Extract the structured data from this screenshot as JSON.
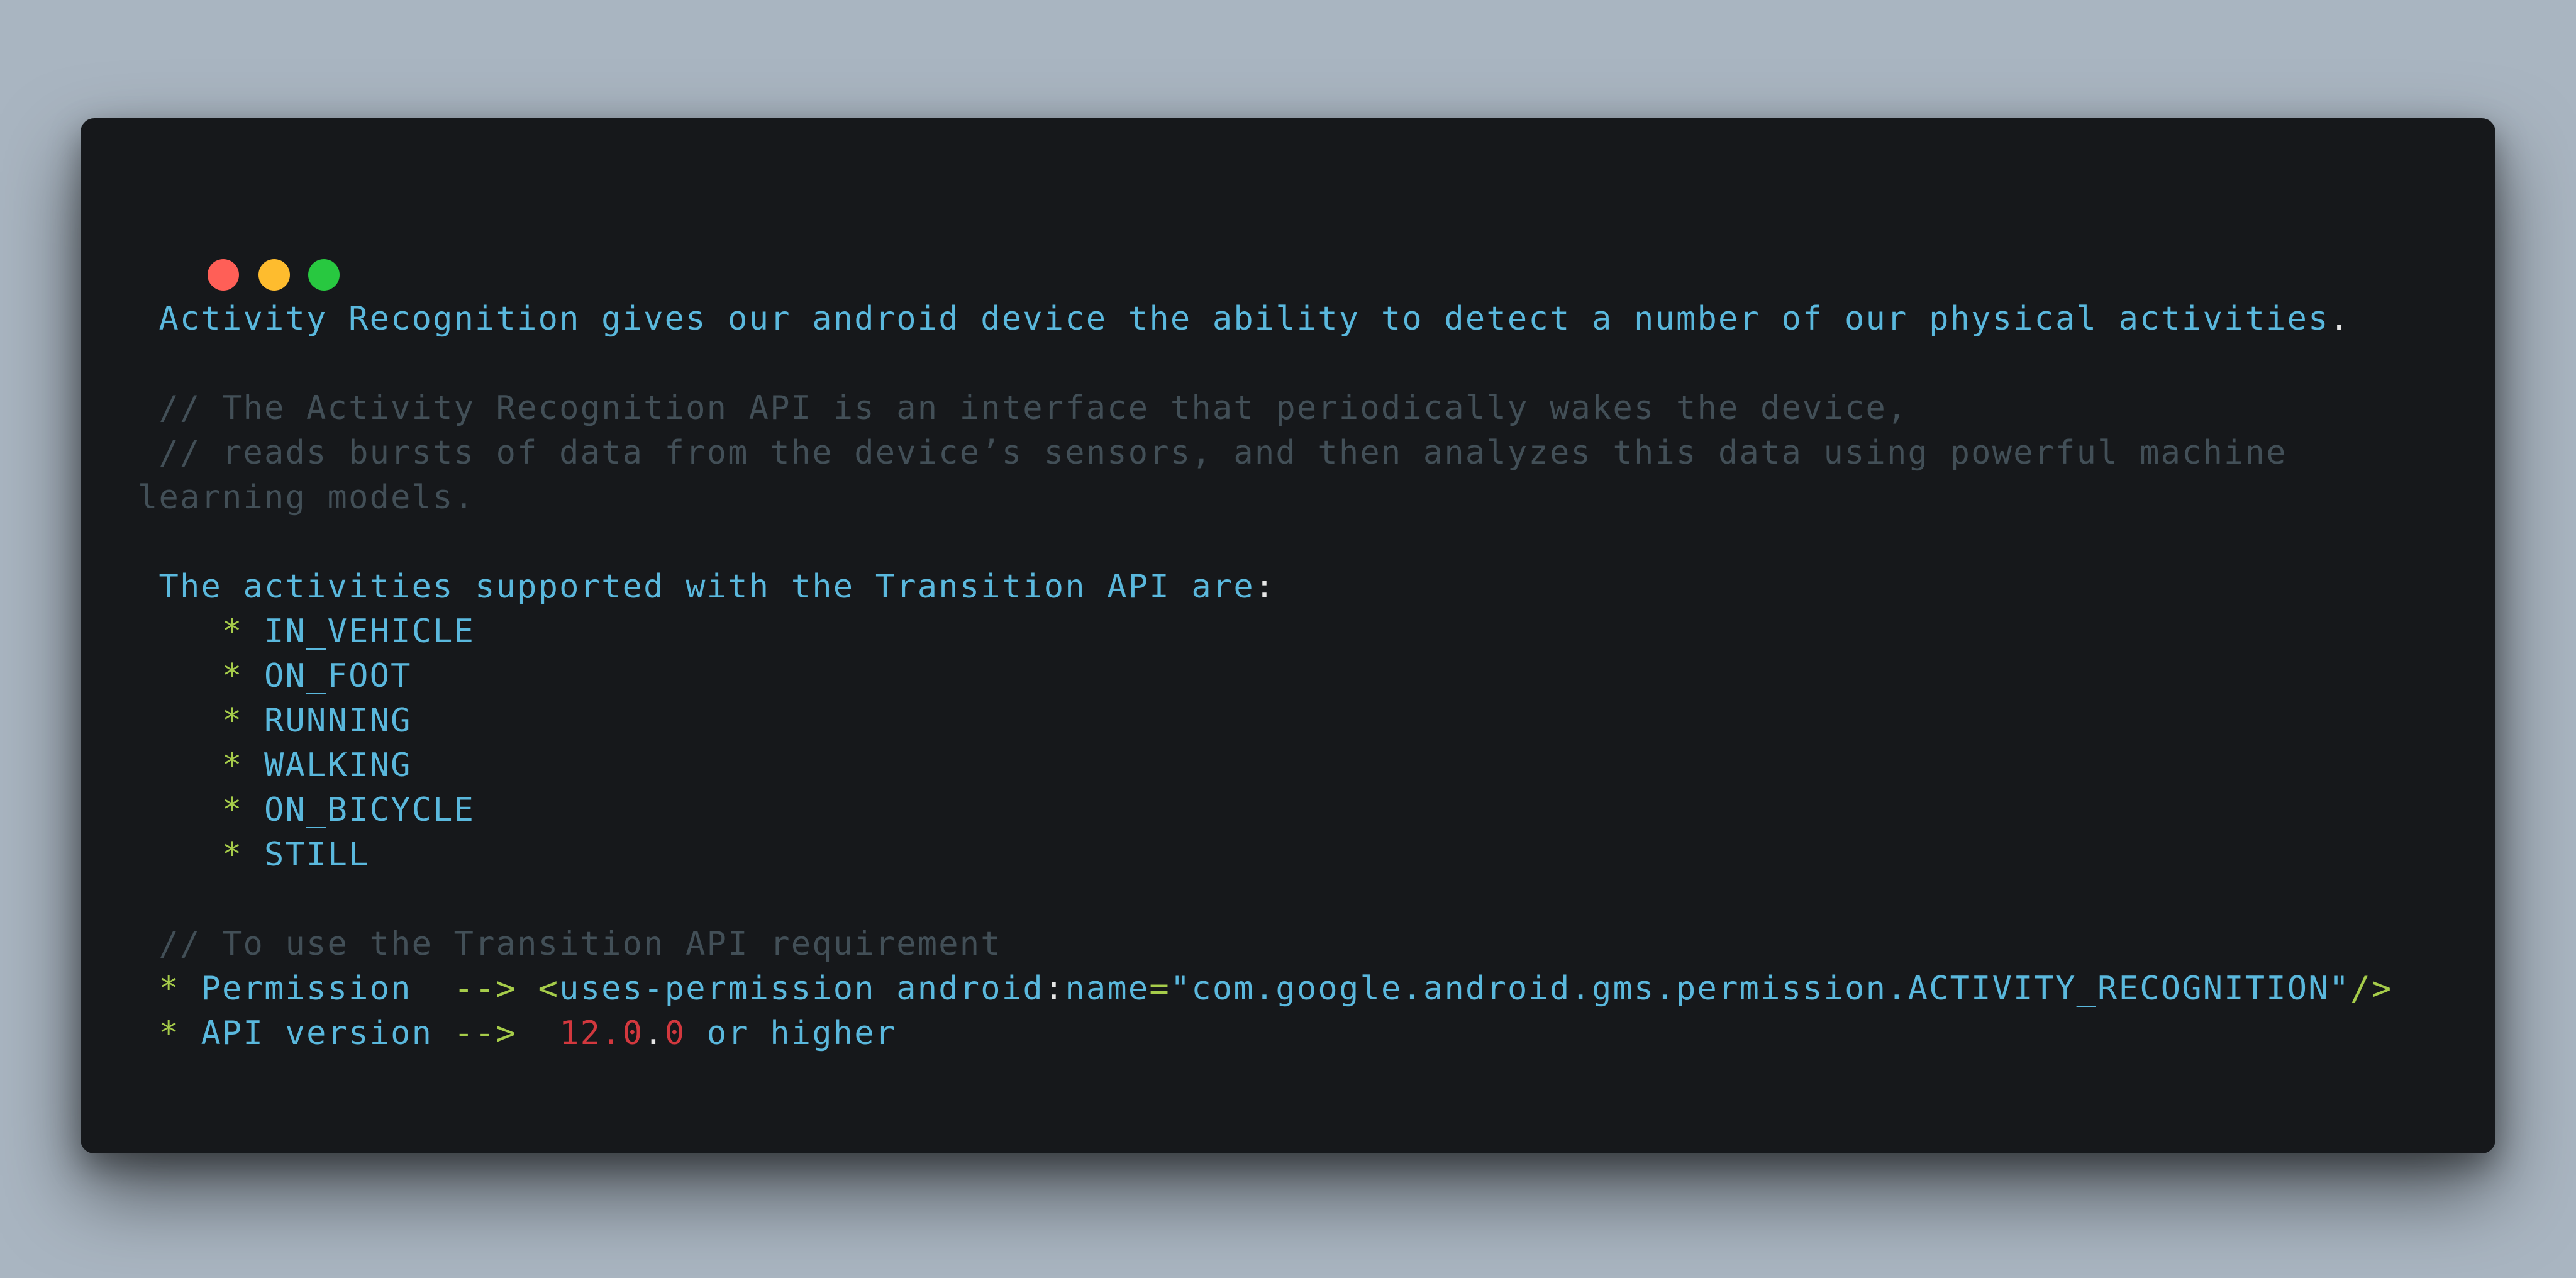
{
  "window": {
    "buttons": [
      {
        "name": "close",
        "color": "#ff5f57"
      },
      {
        "name": "minimize",
        "color": "#febc2e"
      },
      {
        "name": "maximize",
        "color": "#28c840"
      }
    ]
  },
  "colors": {
    "blue": "#5ab8dd",
    "comment": "#424f57",
    "green": "#a6cc4a",
    "red": "#d2383e",
    "white": "#e6e6e6",
    "background": "#16181b",
    "page": "#a9b5c1"
  },
  "lines": [
    [
      {
        "t": " Activity Recognition gives our android device the ability to detect a number of our physical activities",
        "c": "blue"
      },
      {
        "t": ".",
        "c": "white"
      }
    ],
    [],
    [
      {
        "t": " // The Activity Recognition API is an interface that periodically wakes the device,",
        "c": "comment"
      }
    ],
    [
      {
        "t": " // reads bursts of data from the device’s sensors, and then analyzes this data using powerful machine",
        "c": "comment"
      }
    ],
    [
      {
        "t": "learning models.",
        "c": "comment"
      }
    ],
    [],
    [
      {
        "t": " The activities supported with the Transition API are",
        "c": "blue"
      },
      {
        "t": ":",
        "c": "white"
      }
    ],
    [
      {
        "t": "    * ",
        "c": "green"
      },
      {
        "t": "IN_VEHICLE",
        "c": "blue"
      }
    ],
    [
      {
        "t": "    * ",
        "c": "green"
      },
      {
        "t": "ON_FOOT",
        "c": "blue"
      }
    ],
    [
      {
        "t": "    * ",
        "c": "green"
      },
      {
        "t": "RUNNING",
        "c": "blue"
      }
    ],
    [
      {
        "t": "    * ",
        "c": "green"
      },
      {
        "t": "WALKING",
        "c": "blue"
      }
    ],
    [
      {
        "t": "    * ",
        "c": "green"
      },
      {
        "t": "ON_BICYCLE",
        "c": "blue"
      }
    ],
    [
      {
        "t": "    * ",
        "c": "green"
      },
      {
        "t": "STILL",
        "c": "blue"
      }
    ],
    [],
    [
      {
        "t": " // To use the Transition API requirement",
        "c": "comment"
      }
    ],
    [
      {
        "t": " * ",
        "c": "green"
      },
      {
        "t": "Permission  ",
        "c": "blue"
      },
      {
        "t": "--> <",
        "c": "green"
      },
      {
        "t": "uses-permission android",
        "c": "blue"
      },
      {
        "t": ":",
        "c": "white"
      },
      {
        "t": "name",
        "c": "blue"
      },
      {
        "t": "=",
        "c": "green"
      },
      {
        "t": "\"com.google.android.gms.permission.ACTIVITY_RECOGNITION\"",
        "c": "blue"
      },
      {
        "t": "/>",
        "c": "green"
      }
    ],
    [
      {
        "t": " * ",
        "c": "green"
      },
      {
        "t": "API version ",
        "c": "blue"
      },
      {
        "t": "-->  ",
        "c": "green"
      },
      {
        "t": "12.0",
        "c": "red"
      },
      {
        "t": ".",
        "c": "white"
      },
      {
        "t": "0",
        "c": "red"
      },
      {
        "t": " or higher",
        "c": "blue"
      }
    ]
  ]
}
